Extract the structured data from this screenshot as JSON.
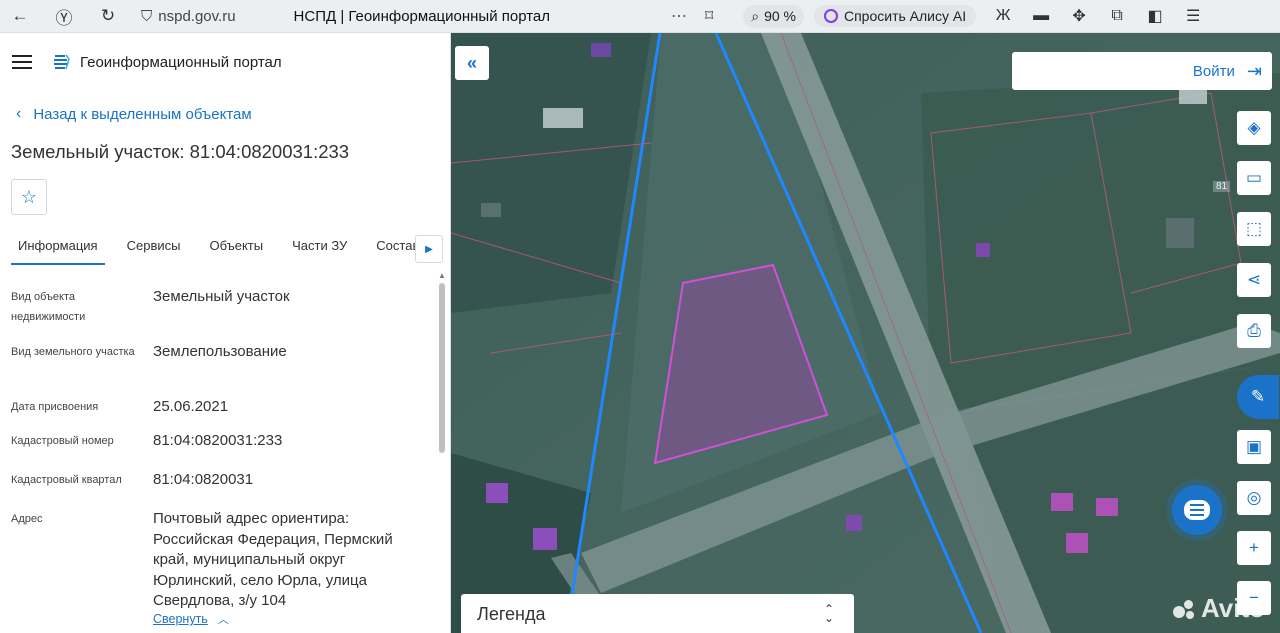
{
  "browser": {
    "host": "nspd.gov.ru",
    "tab_title": "НСПД | Геоинформационный портал",
    "zoom": "90 %",
    "alice": "Спросить Алису AI"
  },
  "panel": {
    "portal_title": "Геоинформационный портал",
    "back_label": "Назад к выделенным объектам",
    "object_title": "Земельный участок: 81:04:0820031:233",
    "tabs": [
      {
        "label": "Информация"
      },
      {
        "label": "Сервисы"
      },
      {
        "label": "Объекты"
      },
      {
        "label": "Части ЗУ"
      },
      {
        "label": "Состав"
      }
    ],
    "properties": [
      {
        "key": "Вид объекта недвижимости",
        "value": "Земельный участок"
      },
      {
        "key": "Вид земельного участка",
        "value": "Землепользование"
      },
      {
        "key": "Дата присвоения",
        "value": "25.06.2021"
      },
      {
        "key": "Кадастровый номер",
        "value": "81:04:0820031:233"
      },
      {
        "key": "Кадастровый квартал",
        "value": "81:04:0820031"
      },
      {
        "key": "Адрес",
        "value": "Почтовый адрес ориентира: Российская Федерация, Пермский край, муниципальный округ Юрлинский, село Юрла, улица Свердлова, з/у 104"
      }
    ],
    "collapse_label": "Свернуть"
  },
  "map": {
    "login_label": "Войти",
    "legend_label": "Легенда",
    "scale_text": "81",
    "watermark": "Avito",
    "parcel_color": "#b03ab8",
    "boundary_color": "#1e88ff"
  }
}
